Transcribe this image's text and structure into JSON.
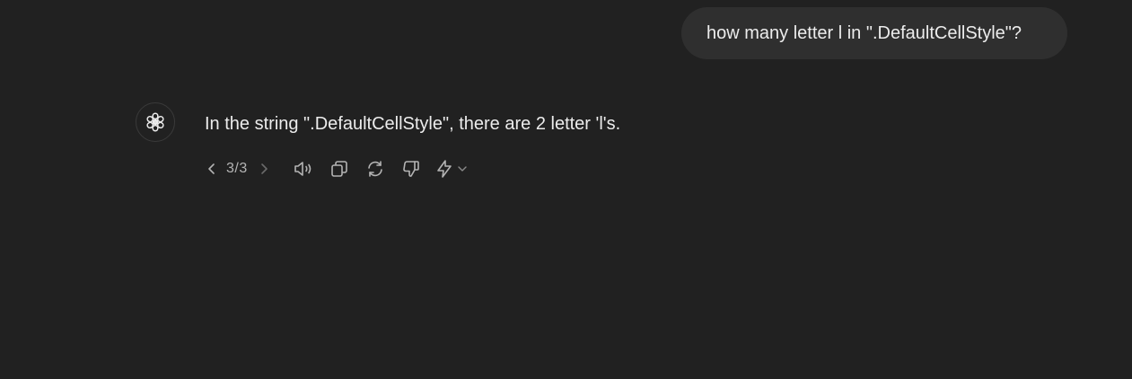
{
  "conversation": {
    "user_message": "how many letter l in \".DefaultCellStyle\"?",
    "assistant_message": "In the string \".DefaultCellStyle\", there are 2 letter 'l's."
  },
  "response_actions": {
    "pager": {
      "label": "3/3",
      "current": 3,
      "total": 3
    },
    "icons": [
      "chevron-left-icon",
      "chevron-right-icon",
      "speaker-icon",
      "copy-icon",
      "regenerate-icon",
      "thumbs-down-icon",
      "lightning-icon",
      "chevron-down-icon"
    ]
  },
  "colors": {
    "background": "#212121",
    "user_bubble": "#2f2f2f",
    "text": "#ececec",
    "icon": "#b4b4b4"
  }
}
